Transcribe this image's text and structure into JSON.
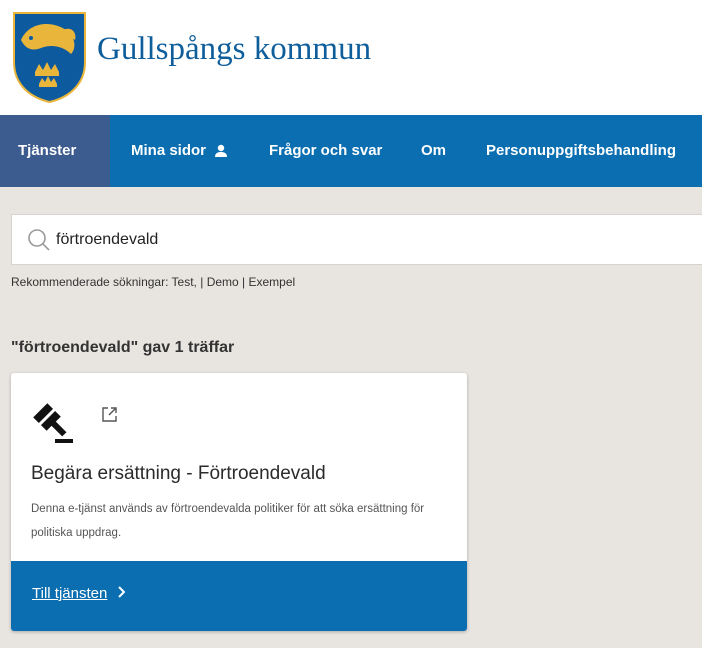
{
  "header": {
    "brand": "Gullspångs kommun"
  },
  "nav": {
    "items": [
      {
        "label": "Tjänster",
        "active": true
      },
      {
        "label": "Mina sidor",
        "icon": "person-icon"
      },
      {
        "label": "Frågor och svar"
      },
      {
        "label": "Om"
      },
      {
        "label": "Personuppgiftsbehandling"
      }
    ]
  },
  "search": {
    "value": "förtroendevald",
    "icon": "search-icon"
  },
  "recommended": {
    "prefix": "Rekommenderade sökningar:",
    "links": [
      "Test,",
      "Demo",
      "Exempel"
    ]
  },
  "results": {
    "heading": "\"förtroendevald\" gav 1 träffar"
  },
  "card": {
    "icon": "gavel-icon",
    "external_icon": "external-link-icon",
    "title": "Begära ersättning - Förtroendevald",
    "description": "Denna e-tjänst används av förtroendevalda politiker för att söka ersättning för politiska uppdrag.",
    "link_label": "Till tjänsten",
    "link_icon": "chevron-right-icon"
  },
  "colors": {
    "primary": "#0a6eb0",
    "nav_active": "#3c5b8f",
    "brand_text": "#0e5e9c",
    "background": "#e8e4e0"
  }
}
